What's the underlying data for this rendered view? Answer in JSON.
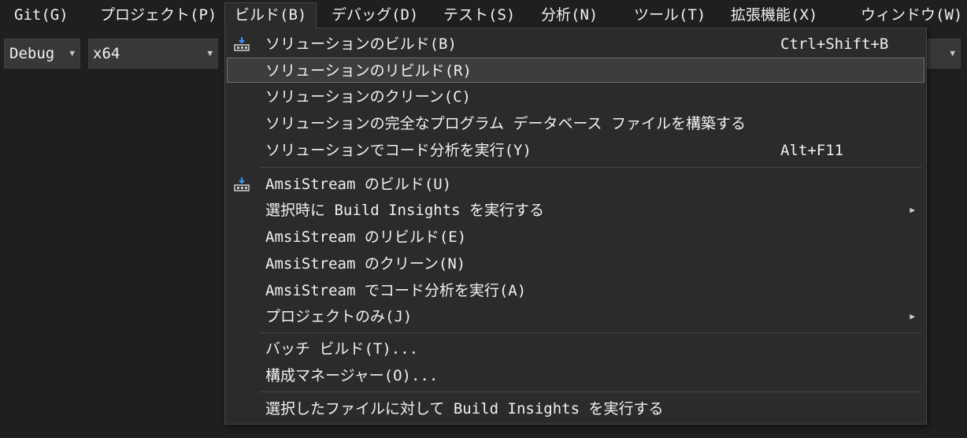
{
  "menubar": {
    "items": [
      {
        "label": "Git(G)"
      },
      {
        "label": "プロジェクト(P)"
      },
      {
        "label": "ビルド(B)"
      },
      {
        "label": "デバッグ(D)"
      },
      {
        "label": "テスト(S)"
      },
      {
        "label": "分析(N)"
      },
      {
        "label": "ツール(T)"
      },
      {
        "label": "拡張機能(X)"
      },
      {
        "label": "ウィンドウ(W)"
      }
    ]
  },
  "toolbar": {
    "configuration": "Debug",
    "platform": "x64"
  },
  "build_menu": {
    "items": [
      {
        "label": "ソリューションのビルド(B)",
        "shortcut": "Ctrl+Shift+B",
        "icon": "build-icon"
      },
      {
        "label": "ソリューションのリビルド(R)",
        "shortcut": ""
      },
      {
        "label": "ソリューションのクリーン(C)",
        "shortcut": ""
      },
      {
        "label": "ソリューションの完全なプログラム データベース ファイルを構築する",
        "shortcut": ""
      },
      {
        "label": "ソリューションでコード分析を実行(Y)",
        "shortcut": "Alt+F11"
      },
      {
        "label": "AmsiStream のビルド(U)",
        "shortcut": "",
        "icon": "build-icon"
      },
      {
        "label": "選択時に Build Insights を実行する",
        "shortcut": "",
        "submenu": true
      },
      {
        "label": "AmsiStream のリビルド(E)",
        "shortcut": ""
      },
      {
        "label": "AmsiStream のクリーン(N)",
        "shortcut": ""
      },
      {
        "label": "AmsiStream でコード分析を実行(A)",
        "shortcut": ""
      },
      {
        "label": "プロジェクトのみ(J)",
        "shortcut": "",
        "submenu": true
      },
      {
        "label": "バッチ ビルド(T)...",
        "shortcut": ""
      },
      {
        "label": "構成マネージャー(O)...",
        "shortcut": ""
      },
      {
        "label": "選択したファイルに対して Build Insights を実行する",
        "shortcut": ""
      }
    ],
    "highlighted_index": 1
  },
  "colors": {
    "background": "#1f1f1f",
    "menu_background": "#2b2b2b",
    "highlight": "#3d3d3d",
    "icon_accent": "#3794ff"
  }
}
